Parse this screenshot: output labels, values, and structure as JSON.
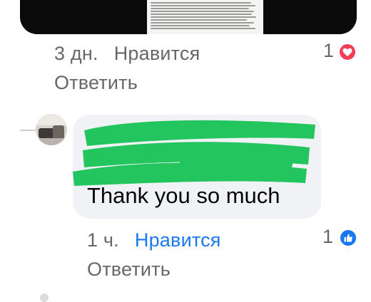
{
  "comment1": {
    "time": "3 дн.",
    "like_label": "Нравится",
    "reply_label": "Ответить",
    "reaction_count": "1",
    "reaction_icon": "heart-love-icon"
  },
  "reply": {
    "text": "Thank you so much",
    "time": "1 ч.",
    "like_label": "Нравится",
    "reply_label": "Ответить",
    "reaction_count": "1",
    "reaction_icon": "thumbs-up-like-icon",
    "author_redacted": true
  },
  "colors": {
    "text_secondary": "#65676b",
    "liked_blue": "#1877f2",
    "love_red": "#f33e58",
    "bubble_bg": "#f0f2f5",
    "redaction_green": "#22c55e"
  }
}
